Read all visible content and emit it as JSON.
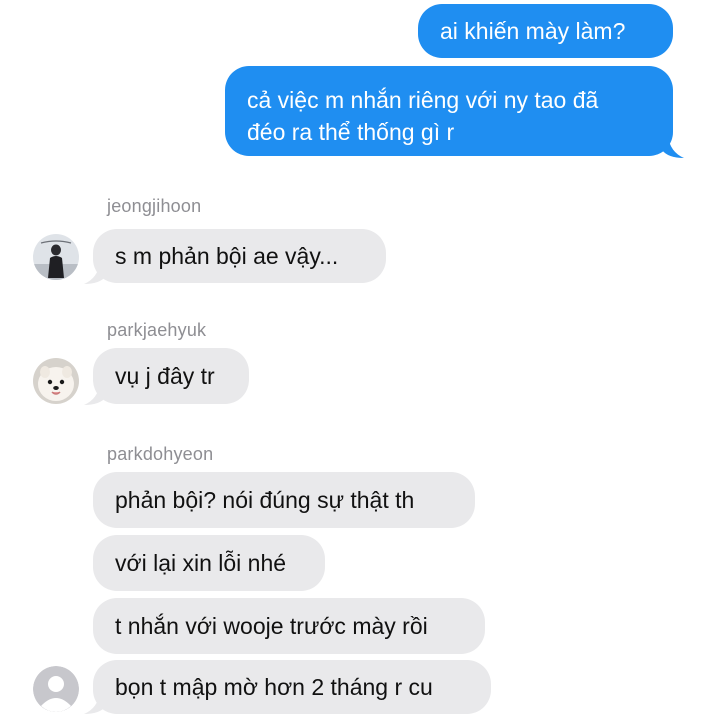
{
  "outgoing": [
    {
      "text": "ai khiến mày làm?"
    },
    {
      "lines": [
        "cả việc m nhắn riêng với ny tao đã",
        "đéo ra thể thống gì r"
      ]
    }
  ],
  "groups": [
    {
      "sender": "jeongjihoon",
      "avatar": "photo-person-avatar",
      "messages": [
        "s m phản bội ae vậy..."
      ]
    },
    {
      "sender": "parkjaehyuk",
      "avatar": "photo-dog-avatar",
      "messages": [
        "vụ j đây tr"
      ]
    },
    {
      "sender": "parkdohyeon",
      "avatar": "default-person-avatar",
      "messages": [
        "phản bội? nói đúng sự thật th",
        "với lại xin lỗi nhé",
        "t nhắn với wooje trước mày rồi",
        "bọn t mập mờ hơn 2 tháng r cu"
      ]
    }
  ],
  "colors": {
    "outgoing_bubble": "#1f8ef1",
    "incoming_bubble": "#e9e9eb",
    "sender_name": "#8e8e93"
  }
}
